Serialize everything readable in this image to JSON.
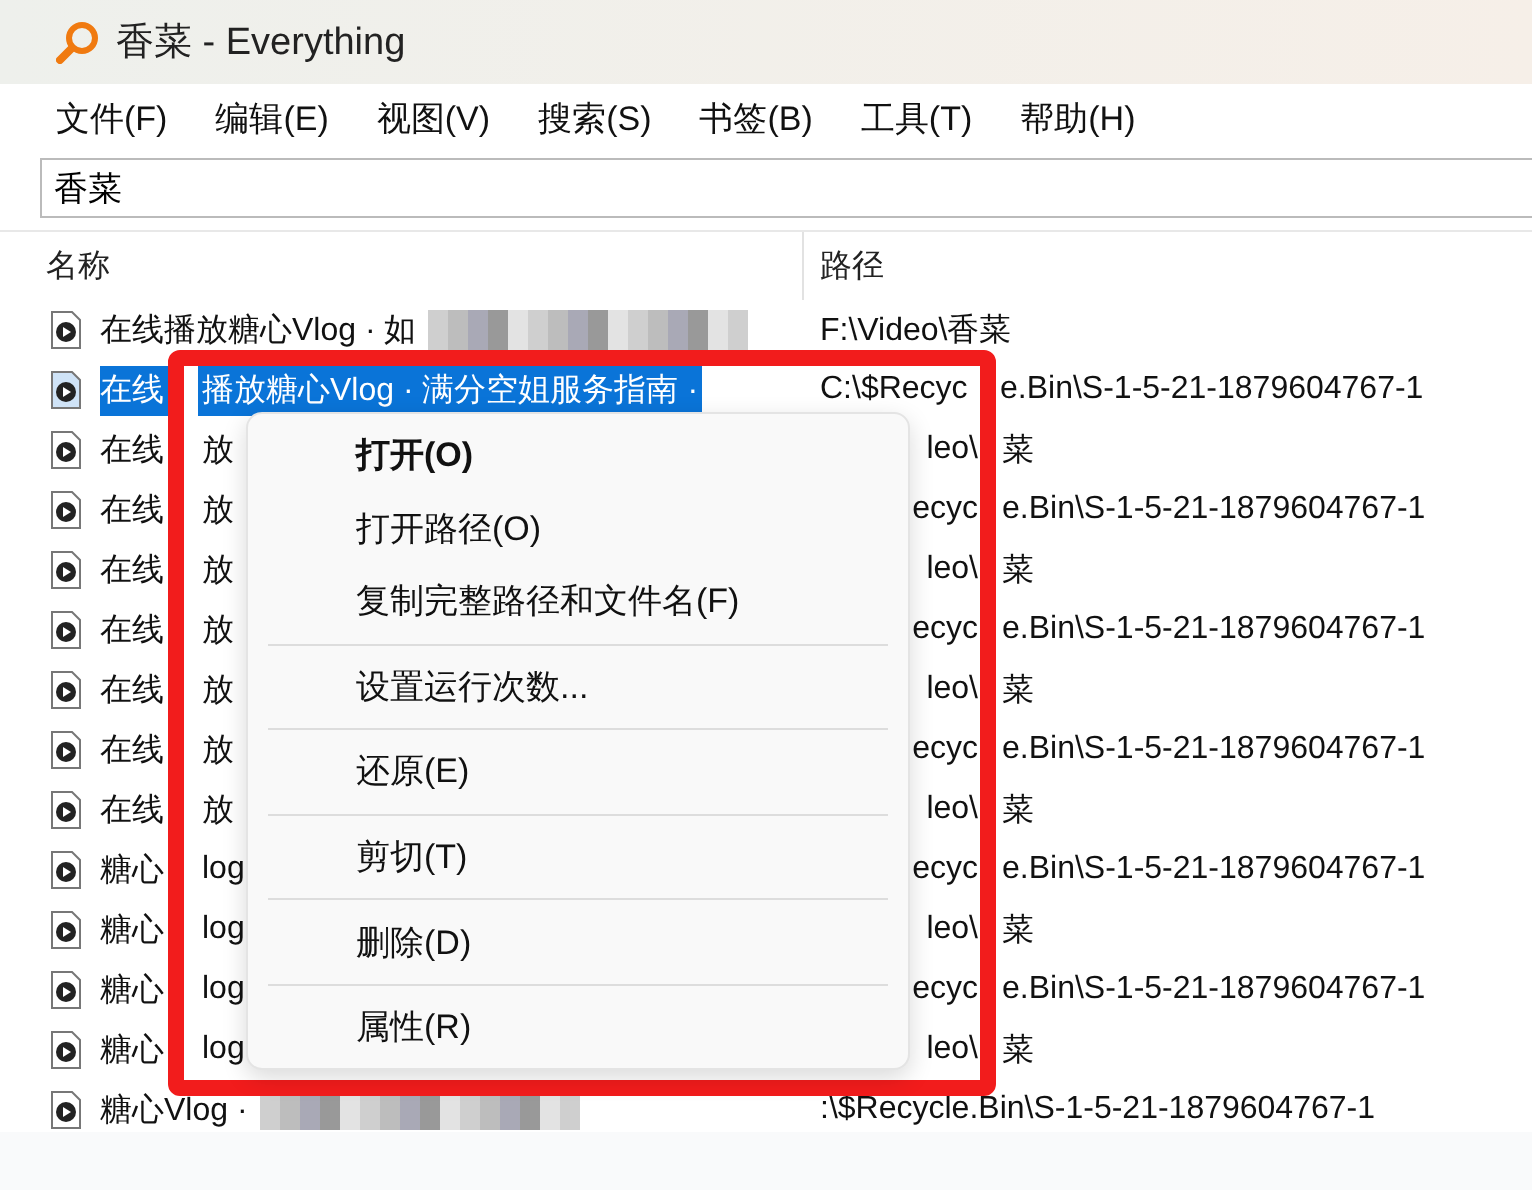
{
  "window": {
    "title": "香菜 - Everything"
  },
  "menu_bar": [
    "文件(F)",
    "编辑(E)",
    "视图(V)",
    "搜索(S)",
    "书签(B)",
    "工具(T)",
    "帮助(H)"
  ],
  "search": {
    "value": "香菜"
  },
  "table": {
    "columns": [
      "名称",
      "路径"
    ],
    "rows": [
      {
        "name_parts": [
          "在线播放糖心Vlog · 如"
        ],
        "redacted": true,
        "path_parts": [
          "F:\\Video\\香菜"
        ],
        "selected": false,
        "covered": false
      },
      {
        "name_parts": [
          "在线",
          "播放糖心Vlog · 满分空姐服务指南 ·"
        ],
        "redacted": false,
        "path_parts": [
          "C:\\$Recyc",
          "e.Bin\\S-1-5-21-1879604767-1"
        ],
        "selected": true,
        "covered": false
      },
      {
        "name_parts": [
          "在线",
          "放"
        ],
        "redacted": false,
        "path_parts": [
          "leo\\",
          "菜"
        ],
        "selected": false,
        "covered": true
      },
      {
        "name_parts": [
          "在线",
          "放"
        ],
        "redacted": false,
        "path_parts": [
          "ecyc",
          "e.Bin\\S-1-5-21-1879604767-1"
        ],
        "selected": false,
        "covered": true
      },
      {
        "name_parts": [
          "在线",
          "放"
        ],
        "redacted": false,
        "path_parts": [
          "leo\\",
          "菜"
        ],
        "selected": false,
        "covered": true
      },
      {
        "name_parts": [
          "在线",
          "放"
        ],
        "redacted": false,
        "path_parts": [
          "ecyc",
          "e.Bin\\S-1-5-21-1879604767-1"
        ],
        "selected": false,
        "covered": true
      },
      {
        "name_parts": [
          "在线",
          "放"
        ],
        "redacted": false,
        "path_parts": [
          "leo\\",
          "菜"
        ],
        "selected": false,
        "covered": true
      },
      {
        "name_parts": [
          "在线",
          "放"
        ],
        "redacted": false,
        "path_parts": [
          "ecyc",
          "e.Bin\\S-1-5-21-1879604767-1"
        ],
        "selected": false,
        "covered": true
      },
      {
        "name_parts": [
          "在线",
          "放"
        ],
        "redacted": false,
        "path_parts": [
          "leo\\",
          "菜"
        ],
        "selected": false,
        "covered": true
      },
      {
        "name_parts": [
          "糖心",
          "log"
        ],
        "redacted": false,
        "path_parts": [
          "ecyc",
          "e.Bin\\S-1-5-21-1879604767-1"
        ],
        "selected": false,
        "covered": true
      },
      {
        "name_parts": [
          "糖心",
          "log"
        ],
        "redacted": false,
        "path_parts": [
          "leo\\",
          "菜"
        ],
        "selected": false,
        "covered": true
      },
      {
        "name_parts": [
          "糖心",
          "log"
        ],
        "redacted": false,
        "path_parts": [
          "ecyc",
          "e.Bin\\S-1-5-21-1879604767-1"
        ],
        "selected": false,
        "covered": true
      },
      {
        "name_parts": [
          "糖心",
          "log"
        ],
        "redacted": false,
        "path_parts": [
          "leo\\",
          "菜"
        ],
        "selected": false,
        "covered": true
      },
      {
        "name_parts": [
          "糖心Vlog ·"
        ],
        "redacted": true,
        "path_parts": [
          ":\\$Recycle.Bin\\S-1-5-21-1879604767-1"
        ],
        "selected": false,
        "covered": false
      }
    ]
  },
  "context_menu": [
    {
      "kind": "default",
      "label": "打开(O)"
    },
    {
      "kind": "item",
      "label": "打开路径(O)"
    },
    {
      "kind": "item",
      "label": "复制完整路径和文件名(F)"
    },
    {
      "kind": "separator"
    },
    {
      "kind": "item",
      "label": "设置运行次数..."
    },
    {
      "kind": "separator"
    },
    {
      "kind": "item",
      "label": "还原(E)"
    },
    {
      "kind": "separator"
    },
    {
      "kind": "item",
      "label": "剪切(T)"
    },
    {
      "kind": "separator"
    },
    {
      "kind": "item",
      "label": "删除(D)"
    },
    {
      "kind": "separator"
    },
    {
      "kind": "item",
      "label": "属性(R)"
    }
  ]
}
